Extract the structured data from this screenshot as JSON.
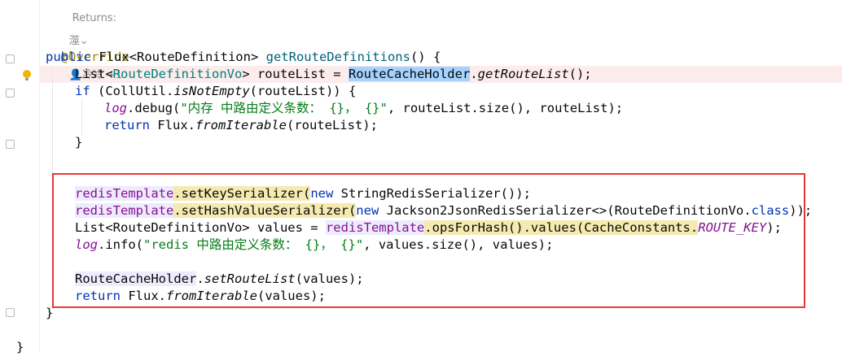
{
  "header": {
    "returns_label": "Returns:",
    "fold_hint": "澨"
  },
  "annotation": {
    "text": "@Override",
    "authors": "冷冷 +1"
  },
  "code": {
    "l1_sig_kw": "public",
    "l1_sig_rest": " Flux<RouteDefinition> ",
    "l1_method": "getRouteDefinitions",
    "l1_tail": "() {",
    "l2_a": "List<",
    "l2_type": "RouteDefinitionVo",
    "l2_b": "> routeList = ",
    "l2_holder": "RouteCacheHolder",
    "l2_dot": ".",
    "l2_call": "getRouteList",
    "l2_end": "();",
    "l3_kw": "if",
    "l3_a": " (CollUtil.",
    "l3_call": "isNotEmpty",
    "l3_b": "(routeList)) {",
    "l4_log": "log",
    "l4_a": ".debug(",
    "l4_str": "\"内存 中路由定义条数： {}， {}\"",
    "l4_b": ", routeList.size(), routeList);",
    "l5_kw": "return",
    "l5_a": " Flux.",
    "l5_call": "fromIterable",
    "l5_b": "(routeList);",
    "l6": "}",
    "l7_field": "redisTemplate",
    "l7_a": ".setKeySerializer(",
    "l7_kw": "new",
    "l7_b": " StringRedisSerializer());",
    "l8_field": "redisTemplate",
    "l8_a": ".setHashValueSerializer(",
    "l8_kw": "new",
    "l8_b": " Jackson2JsonRedisSerializer<>(RouteDefinitionVo.",
    "l8_cls": "class",
    "l8_c": "));",
    "l9_a": "List<RouteDefinitionVo> values = ",
    "l9_field": "redisTemplate",
    "l9_b": ".opsForHash().values(CacheConstants.",
    "l9_const": "ROUTE_KEY",
    "l9_c": ");",
    "l10_log": "log",
    "l10_a": ".info(",
    "l10_str": "\"redis 中路由定义条数： {}， {}\"",
    "l10_b": ", values.size(), values);",
    "l11_holder": "RouteCacheHolder",
    "l11_a": ".",
    "l11_call": "setRouteList",
    "l11_b": "(values);",
    "l12_kw": "return",
    "l12_a": " Flux.",
    "l12_call": "fromIterable",
    "l12_b": "(values);",
    "l13": "}",
    "l14": "}"
  }
}
